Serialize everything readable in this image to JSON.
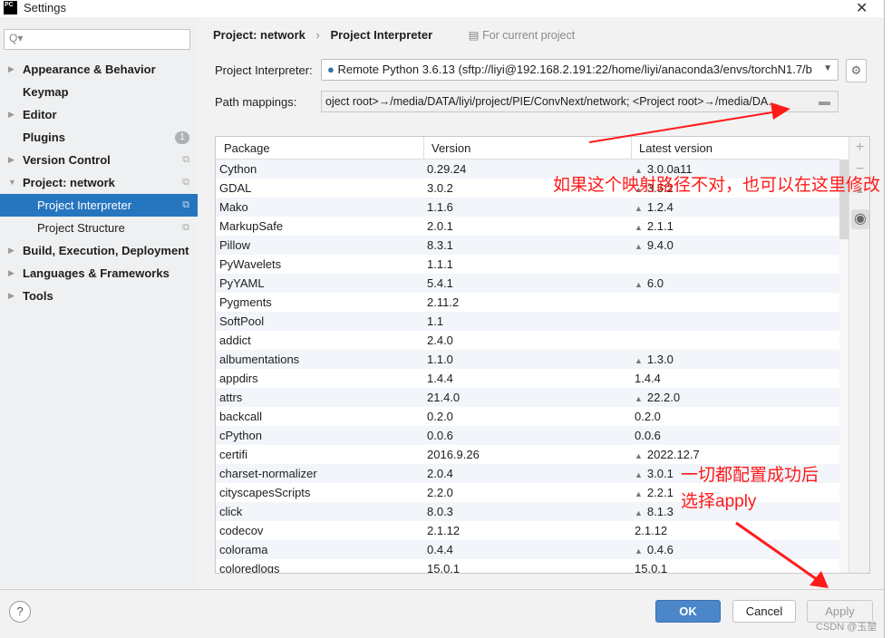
{
  "window": {
    "title": "Settings",
    "logo": "PC",
    "close": "✕"
  },
  "search": {
    "placeholder": "Q▾"
  },
  "sidebar": {
    "items": [
      {
        "label": "Appearance & Behavior",
        "expand": "▶"
      },
      {
        "label": "Keymap"
      },
      {
        "label": "Editor",
        "expand": "▶"
      },
      {
        "label": "Plugins",
        "badge": "1"
      },
      {
        "label": "Version Control",
        "expand": "▶"
      },
      {
        "label": "Project: network",
        "expand": "▼"
      },
      {
        "label": "Project Interpreter",
        "selected": true
      },
      {
        "label": "Project Structure"
      },
      {
        "label": "Build, Execution, Deployment",
        "expand": "▶"
      },
      {
        "label": "Languages & Frameworks",
        "expand": "▶"
      },
      {
        "label": "Tools",
        "expand": "▶"
      }
    ]
  },
  "breadcrumb": {
    "project": "Project: network",
    "sep": "›",
    "page": "Project Interpreter",
    "scope": "For current project"
  },
  "interpreter": {
    "label": "Project Interpreter:",
    "value": "Remote Python 3.6.13 (sftp://liyi@192.168.2.191:22/home/liyi/anaconda3/envs/torchN1.7/b"
  },
  "paths": {
    "label": "Path mappings:",
    "value": "oject root>→/media/DATA/liyi/project/PIE/ConvNext/network; <Project root>→/media/DA..."
  },
  "table": {
    "headers": [
      "Package",
      "Version",
      "Latest version"
    ],
    "rows": [
      [
        "Cython",
        "0.29.24",
        "3.0.0a11",
        true
      ],
      [
        "GDAL",
        "3.0.2",
        "3.5.2",
        true
      ],
      [
        "Mako",
        "1.1.6",
        "1.2.4",
        true
      ],
      [
        "MarkupSafe",
        "2.0.1",
        "2.1.1",
        true
      ],
      [
        "Pillow",
        "8.3.1",
        "9.4.0",
        true
      ],
      [
        "PyWavelets",
        "1.1.1",
        "",
        false
      ],
      [
        "PyYAML",
        "5.4.1",
        "6.0",
        true
      ],
      [
        "Pygments",
        "2.11.2",
        "",
        false
      ],
      [
        "SoftPool",
        "1.1",
        "",
        false
      ],
      [
        "addict",
        "2.4.0",
        "",
        false
      ],
      [
        "albumentations",
        "1.1.0",
        "1.3.0",
        true
      ],
      [
        "appdirs",
        "1.4.4",
        "1.4.4",
        false
      ],
      [
        "attrs",
        "21.4.0",
        "22.2.0",
        true
      ],
      [
        "backcall",
        "0.2.0",
        "0.2.0",
        false
      ],
      [
        "cPython",
        "0.0.6",
        "0.0.6",
        false
      ],
      [
        "certifi",
        "2016.9.26",
        "2022.12.7",
        true
      ],
      [
        "charset-normalizer",
        "2.0.4",
        "3.0.1",
        true
      ],
      [
        "cityscapesScripts",
        "2.2.0",
        "2.2.1",
        true
      ],
      [
        "click",
        "8.0.3",
        "8.1.3",
        true
      ],
      [
        "codecov",
        "2.1.12",
        "2.1.12",
        false
      ],
      [
        "colorama",
        "0.4.4",
        "0.4.6",
        true
      ],
      [
        "coloredlogs",
        "15.0.1",
        "15.0.1",
        false
      ]
    ]
  },
  "buttons": {
    "ok": "OK",
    "cancel": "Cancel",
    "apply": "Apply",
    "help": "?"
  },
  "annotations": {
    "note1": "如果这个映射路径不对，也可以在这里修改",
    "note2a": "一切都配置成功后",
    "note2b": "选择apply",
    "color": "#ff1a1a"
  },
  "watermark": "CSDN @玉堃"
}
